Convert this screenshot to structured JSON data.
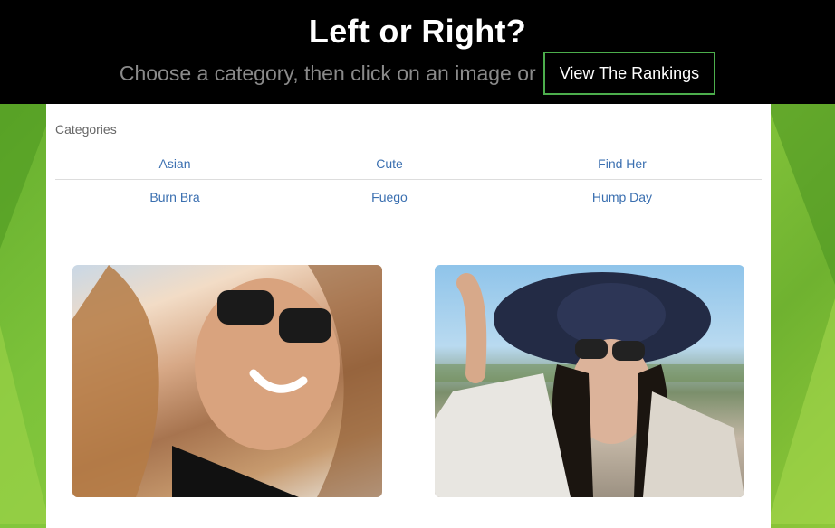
{
  "header": {
    "title": "Left or Right?",
    "subtitle": "Choose a category, then click on an image or",
    "rankings_button": "View The Rankings"
  },
  "categories": {
    "label": "Categories",
    "items": [
      "Asian",
      "Cute",
      "Find Her",
      "Burn Bra",
      "Fuego",
      "Hump Day"
    ]
  },
  "images": {
    "left": "photo of smiling woman with sunglasses (selfie)",
    "right": "photo of woman in wide navy sun hat and sunglasses"
  },
  "colors": {
    "header_bg": "#000000",
    "button_border": "#4cae4c",
    "link": "#3a6fb0",
    "background_green": "#7cc23a"
  }
}
